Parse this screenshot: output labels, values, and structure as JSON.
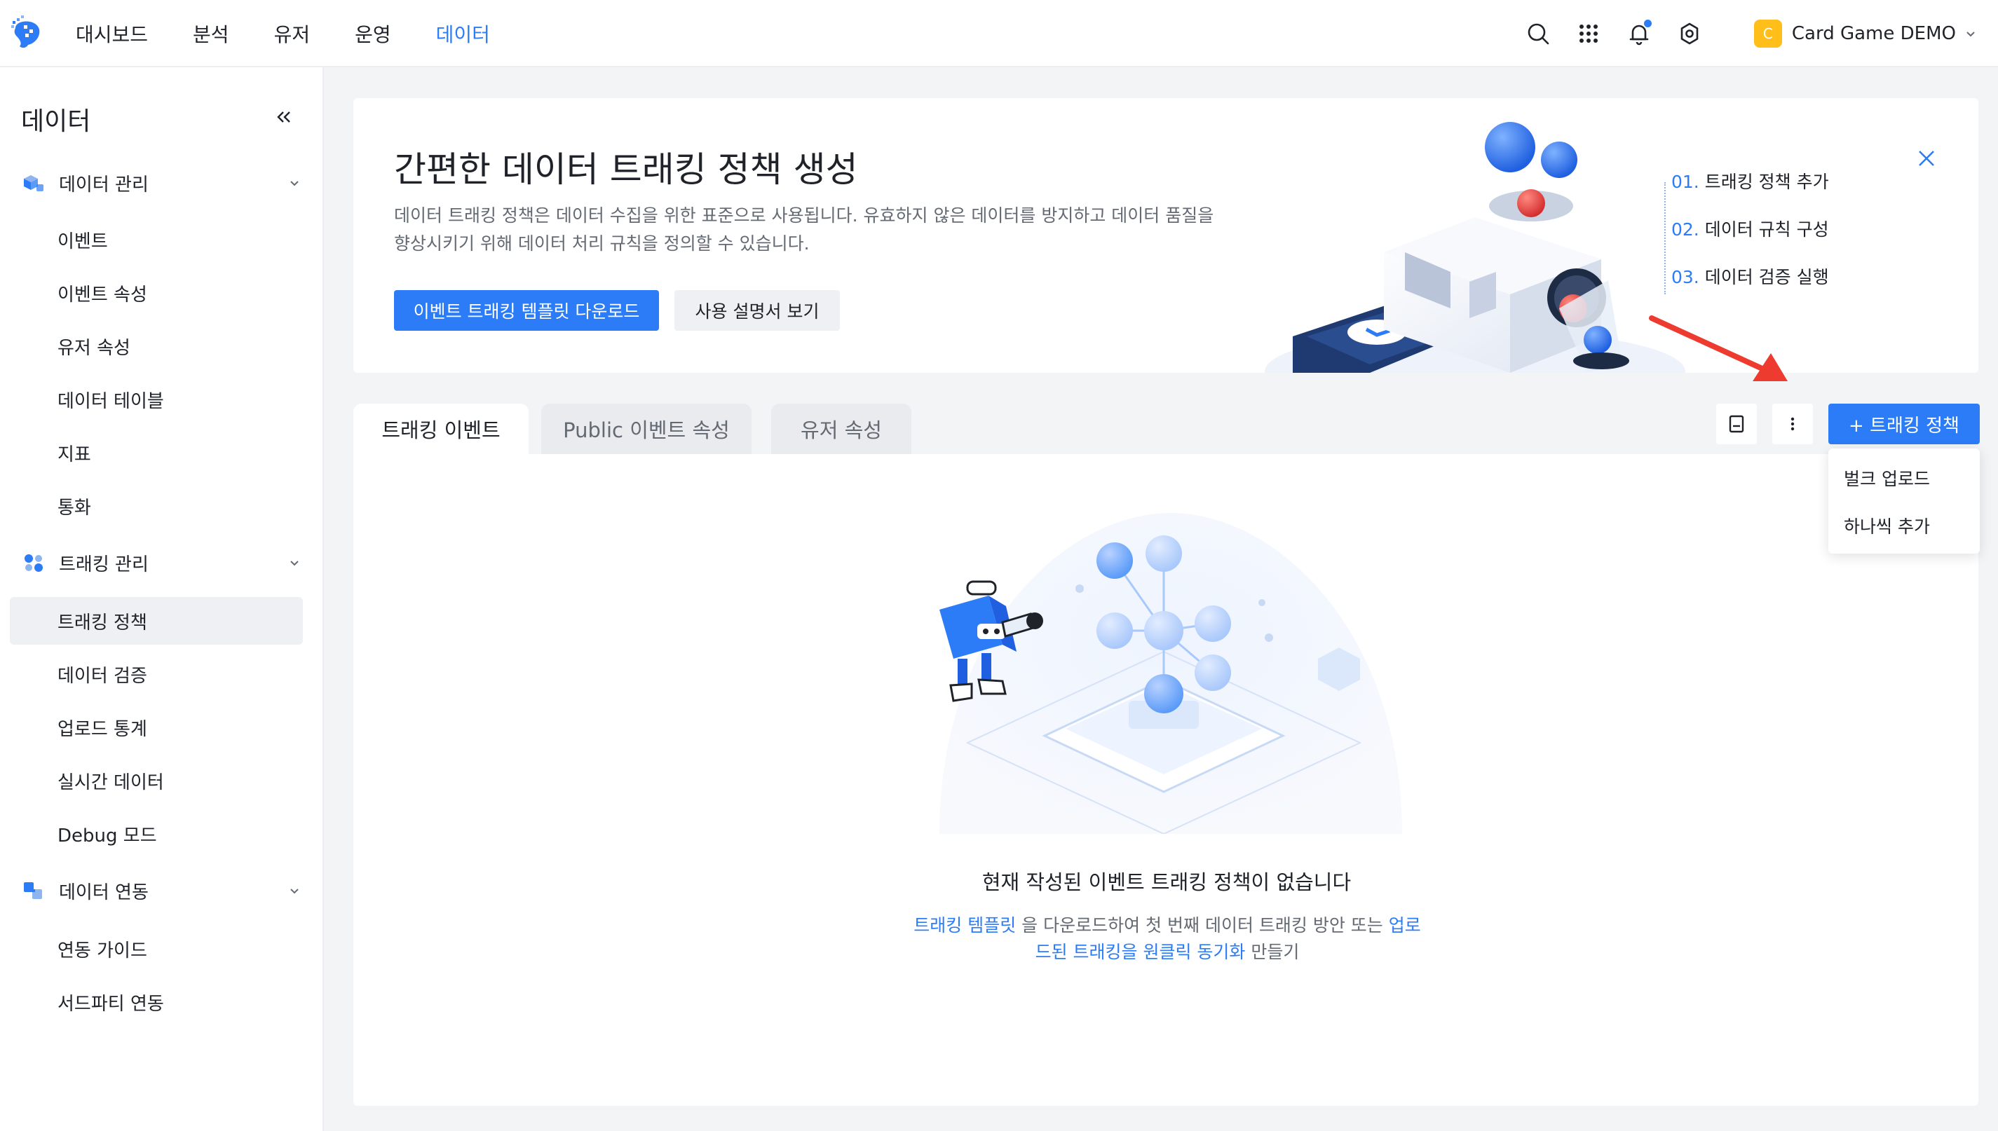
{
  "topnav": {
    "items": [
      {
        "label": "대시보드",
        "active": false
      },
      {
        "label": "분석",
        "active": false
      },
      {
        "label": "유저",
        "active": false
      },
      {
        "label": "운영",
        "active": false
      },
      {
        "label": "데이터",
        "active": true
      }
    ],
    "icons": [
      "search-icon",
      "apps-grid-icon",
      "bell-icon",
      "settings-icon"
    ],
    "project": {
      "badge": "C",
      "name": "Card Game DEMO"
    },
    "accent": "#2b7cf6",
    "badge_color": "#ffbe1a"
  },
  "sidebar": {
    "title": "데이터",
    "groups": [
      {
        "label": "데이터 관리",
        "icon": "cubes-icon",
        "items": [
          "이벤트",
          "이벤트 속성",
          "유저 속성",
          "데이터 테이블",
          "지표",
          "통화"
        ]
      },
      {
        "label": "트래킹 관리",
        "icon": "nodes-icon",
        "items": [
          "트래킹 정책",
          "데이터 검증",
          "업로드 통계",
          "실시간 데이터",
          "Debug 모드"
        ],
        "active_item": "트래킹 정책"
      },
      {
        "label": "데이터 연동",
        "icon": "link-icon",
        "items": [
          "연동 가이드",
          "서드파티 연동"
        ]
      }
    ]
  },
  "banner": {
    "title": "간편한 데이터 트래킹 정책 생성",
    "description": "데이터 트래킹 정책은 데이터 수집을 위한 표준으로 사용됩니다. 유효하지 않은 데이터를 방지하고 데이터 품질을 향상시키기 위해 데이터 처리 규칙을 정의할 수 있습니다.",
    "primary_button": "이벤트 트래킹 템플릿 다운로드",
    "secondary_button": "사용 설명서 보기",
    "steps": [
      {
        "num": "01.",
        "label": "트래킹 정책 추가"
      },
      {
        "num": "02.",
        "label": "데이터 규칙 구성"
      },
      {
        "num": "03.",
        "label": "데이터 검증 실행"
      }
    ]
  },
  "tabs": [
    {
      "label": "트래킹 이벤트",
      "active": true
    },
    {
      "label": "Public 이벤트 속성",
      "active": false
    },
    {
      "label": "유저 속성",
      "active": false
    }
  ],
  "toolbar": {
    "add_policy_label": "+ 트래킹 정책",
    "dropdown": [
      "벌크 업로드",
      "하나씩 추가"
    ]
  },
  "empty_state": {
    "title": "현재 작성된 이벤트 트래킹 정책이 없습니다",
    "link1": "트래킹 템플릿",
    "text1": " 을 다운로드하여 첫 번째 데이터 트래킹 방안 또는 ",
    "link2": "업로드된 트래킹을 원클릭 동기화",
    "text2": " 만들기"
  }
}
